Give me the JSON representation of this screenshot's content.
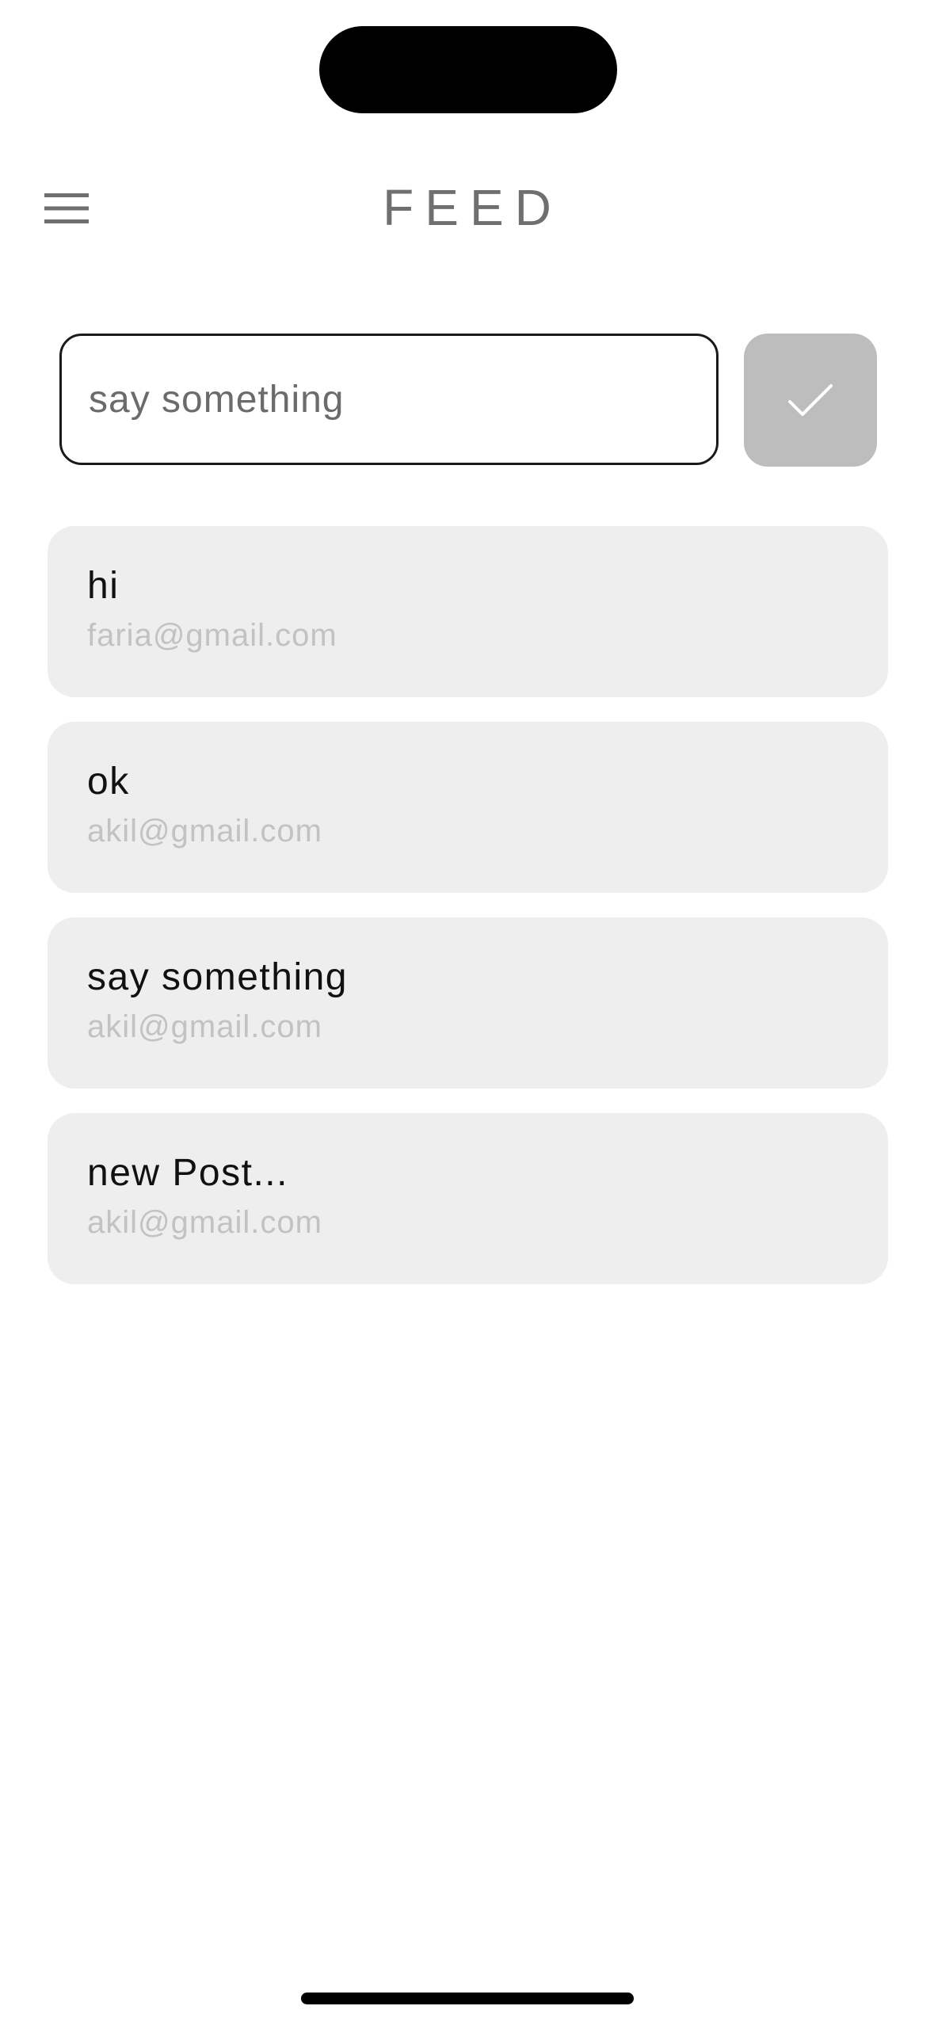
{
  "header": {
    "title": "FEED",
    "menu_icon": "hamburger-menu-icon"
  },
  "composer": {
    "placeholder": "say something",
    "value": "",
    "submit_icon": "checkmark-icon"
  },
  "posts": [
    {
      "message": "hi",
      "author_email": "faria@gmail.com"
    },
    {
      "message": "ok",
      "author_email": "akil@gmail.com"
    },
    {
      "message": "say something",
      "author_email": "akil@gmail.com"
    },
    {
      "message": "new Post...",
      "author_email": "akil@gmail.com"
    }
  ],
  "colors": {
    "title": "#6f6f6f",
    "card_background": "#eeeeee",
    "email_text": "#c2c2c2",
    "submit_button": "#bdbdbd"
  }
}
